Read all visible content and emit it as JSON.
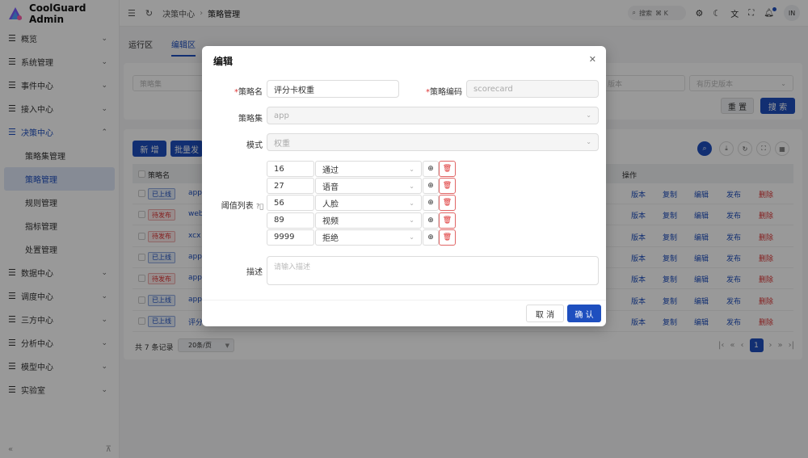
{
  "app": {
    "title": "CoolGuard Admin"
  },
  "colors": {
    "primary": "#1e4fbf",
    "danger": "#dd3333",
    "online_bg": "#e7eefb",
    "pending_bg": "#fdecec"
  },
  "sidebar": {
    "items": [
      {
        "label": "概览",
        "icon": "menu-icon"
      },
      {
        "label": "系统管理",
        "icon": "menu-icon"
      },
      {
        "label": "事件中心",
        "icon": "menu-icon"
      },
      {
        "label": "接入中心",
        "icon": "menu-icon"
      },
      {
        "label": "决策中心",
        "icon": "menu-icon",
        "open": true
      },
      {
        "label": "数据中心",
        "icon": "menu-icon"
      },
      {
        "label": "调度中心",
        "icon": "menu-icon"
      },
      {
        "label": "三方中心",
        "icon": "menu-icon"
      },
      {
        "label": "分析中心",
        "icon": "menu-icon"
      },
      {
        "label": "模型中心",
        "icon": "menu-icon"
      },
      {
        "label": "实验室",
        "icon": "menu-icon"
      }
    ],
    "subitems": [
      "策略集管理",
      "策略管理",
      "规则管理",
      "指标管理",
      "处置管理"
    ],
    "active_subitem": "策略管理",
    "footer_left": "«",
    "footer_right": "⊼"
  },
  "topbar": {
    "breadcrumb": [
      "决策中心",
      "策略管理"
    ],
    "search_label": "搜索",
    "search_shortcut": "⌘ K",
    "avatar": "IN"
  },
  "tabs": [
    {
      "label": "运行区",
      "active": false
    },
    {
      "label": "编辑区",
      "active": true
    }
  ],
  "filters": {
    "strategy_set_placeholder": "策略集",
    "version_placeholder": "版本",
    "history_placeholder": "有历史版本",
    "reset_label": "重 置",
    "search_label": "搜 索"
  },
  "table": {
    "add_label": "新 增",
    "batch_label": "批量发",
    "headers": {
      "name": "策略名",
      "actions": "操作"
    },
    "action_labels": [
      "版本",
      "复制",
      "编辑",
      "发布",
      "删除"
    ],
    "rows": [
      {
        "status": "已上线",
        "status_type": "online",
        "name": "app"
      },
      {
        "status": "待发布",
        "status_type": "pending",
        "name": "web"
      },
      {
        "status": "待发布",
        "status_type": "pending",
        "name": "xcx"
      },
      {
        "status": "已上线",
        "status_type": "online",
        "name": "app"
      },
      {
        "status": "待发布",
        "status_type": "pending",
        "name": "app"
      },
      {
        "status": "已上线",
        "status_type": "online",
        "name": "app"
      },
      {
        "status": "已上线",
        "status_type": "online",
        "name": "评分"
      }
    ],
    "total_text": "共 7 条记录",
    "page_size": "20条/页",
    "current_page": "1"
  },
  "modal": {
    "title": "编辑",
    "fields": {
      "name_label": "策略名",
      "name_value": "评分卡权重",
      "code_label": "策略编码",
      "code_value": "scorecard",
      "set_label": "策略集",
      "set_value": "app",
      "mode_label": "模式",
      "mode_value": "权重",
      "threshold_label": "阈值列表",
      "desc_label": "描述",
      "desc_placeholder": "请输入描述"
    },
    "thresholds": [
      {
        "value": "16",
        "result": "通过"
      },
      {
        "value": "27",
        "result": "语音"
      },
      {
        "value": "56",
        "result": "人脸"
      },
      {
        "value": "89",
        "result": "视频"
      },
      {
        "value": "9999",
        "result": "拒绝"
      }
    ],
    "cancel_label": "取 消",
    "confirm_label": "确 认"
  }
}
